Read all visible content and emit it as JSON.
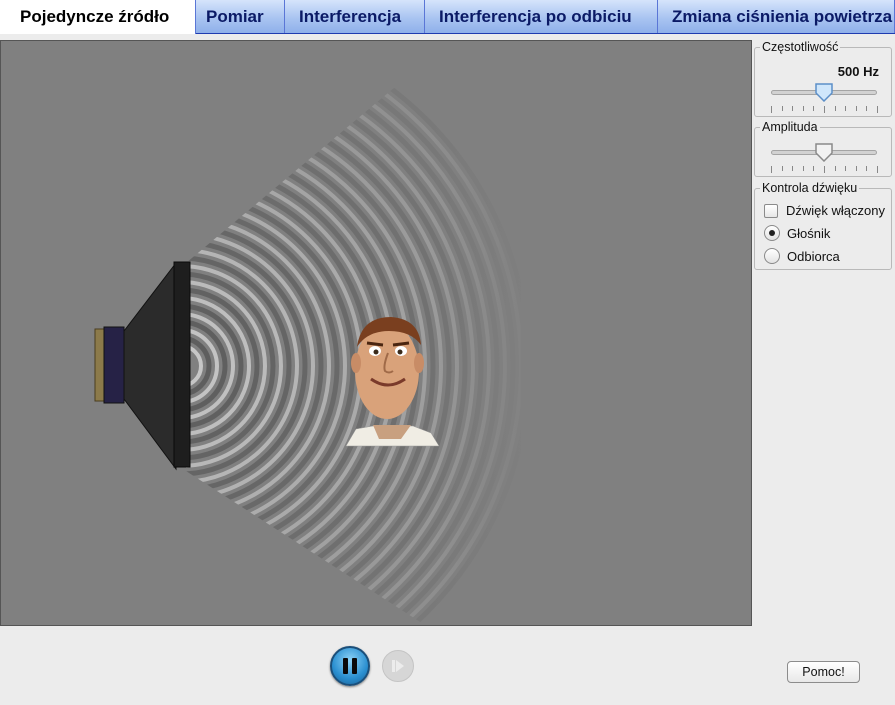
{
  "tabs": [
    {
      "label": "Pojedyncze źródło",
      "active": true
    },
    {
      "label": "Pomiar",
      "active": false
    },
    {
      "label": "Interferencja",
      "active": false
    },
    {
      "label": "Interferencja po odbiciu",
      "active": false
    },
    {
      "label": "Zmiana ciśnienia powietrza",
      "active": false
    }
  ],
  "controls": {
    "frequency": {
      "title": "Częstotliwość",
      "value": "500 Hz",
      "level": 0.5
    },
    "amplitude": {
      "title": "Amplituda",
      "level": 0.5
    },
    "sound": {
      "title": "Kontrola dźwięku",
      "enabled_label": "Dźwięk włączony",
      "enabled": false,
      "speaker_label": "Głośnik",
      "listener_label": "Odbiorca",
      "selected": "speaker"
    }
  },
  "playback": {
    "state": "playing"
  },
  "help_label": "Pomoc!",
  "colors": {
    "tab_active": "#ffffff",
    "tab_inactive": "#a9c4f1",
    "sim_bg": "#808080",
    "accent": "#2a8fd0"
  },
  "icons": [
    "pause-icon",
    "step-icon",
    "speaker-icon",
    "listener-face-icon"
  ]
}
